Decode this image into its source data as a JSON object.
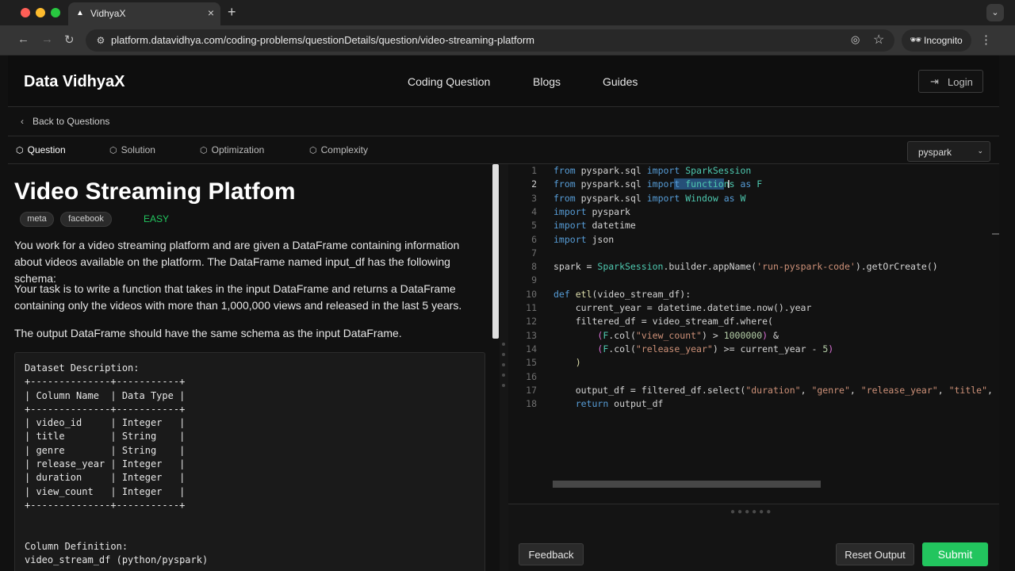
{
  "browser": {
    "tab_title": "VidhyaX",
    "url": "platform.datavidhya.com/coding-problems/questionDetails/question/video-streaming-platform",
    "incognito_label": "Incognito"
  },
  "header": {
    "brand": "Data VidhyaX",
    "nav": [
      "Coding Question",
      "Blogs",
      "Guides"
    ],
    "login_label": "Login"
  },
  "back_label": "Back to Questions",
  "tabs": [
    "Question",
    "Solution",
    "Optimization",
    "Complexity"
  ],
  "language": "pyspark",
  "question": {
    "title": "Video Streaming Platfom",
    "tags": [
      "meta",
      "facebook"
    ],
    "difficulty": "EASY",
    "paragraphs": [
      "You work for a video streaming platform and are given a DataFrame containing information about videos available on the platform. The DataFrame named input_df has the following schema:",
      "Your task is to write a function that takes in the input DataFrame and returns a DataFrame containing only the videos with more than 1,000,000 views and released in the last 5 years.",
      "The output DataFrame should have the same schema as the input DataFrame."
    ],
    "dataset_text": "Dataset Description:\n+--------------+-----------+\n| Column Name  | Data Type |\n+--------------+-----------+\n| video_id     | Integer   |\n| title        | String    |\n| genre        | String    |\n| release_year | Integer   |\n| duration     | Integer   |\n| view_count   | Integer   |\n+--------------+-----------+\n\n\nColumn Definition:\nvideo_stream_df (python/pyspark)"
  },
  "editor": {
    "line_numbers": [
      "1",
      "2",
      "3",
      "4",
      "5",
      "6",
      "7",
      "8",
      "9",
      "10",
      "11",
      "12",
      "13",
      "14",
      "15",
      "16",
      "17",
      "18"
    ],
    "active_line": 2
  },
  "buttons": {
    "feedback": "Feedback",
    "reset": "Reset Output",
    "submit": "Submit"
  },
  "colors": {
    "accent_green": "#22c55e",
    "keyword": "#569cd6",
    "class": "#4ec9b0",
    "string": "#ce9178"
  }
}
